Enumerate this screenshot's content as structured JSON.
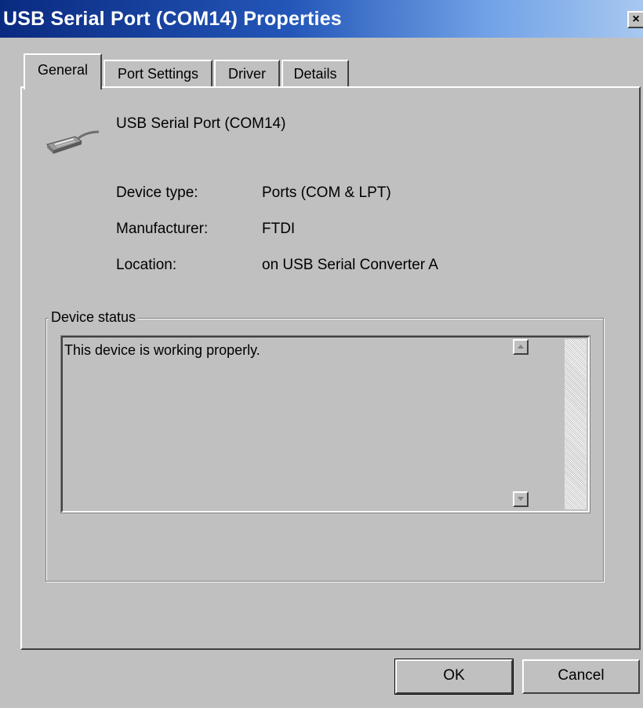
{
  "window": {
    "title": "USB Serial Port (COM14) Properties",
    "close_label": "×"
  },
  "tabs": [
    {
      "label": "General",
      "active": true
    },
    {
      "label": "Port Settings",
      "active": false
    },
    {
      "label": "Driver",
      "active": false
    },
    {
      "label": "Details",
      "active": false
    }
  ],
  "device": {
    "name": "USB Serial Port (COM14)",
    "icon": "serial-port-connector-icon",
    "properties": [
      {
        "label": "Device type:",
        "value": "Ports (COM & LPT)"
      },
      {
        "label": "Manufacturer:",
        "value": "FTDI"
      },
      {
        "label": "Location:",
        "value": "on USB Serial Converter A"
      }
    ]
  },
  "status": {
    "group_label": "Device status",
    "text": "This device is working properly."
  },
  "buttons": {
    "ok": "OK",
    "cancel": "Cancel"
  },
  "colors": {
    "title_gradient_start": "#0a2a80",
    "title_gradient_end": "#a8c8f0",
    "face": "#c0c0c0"
  }
}
